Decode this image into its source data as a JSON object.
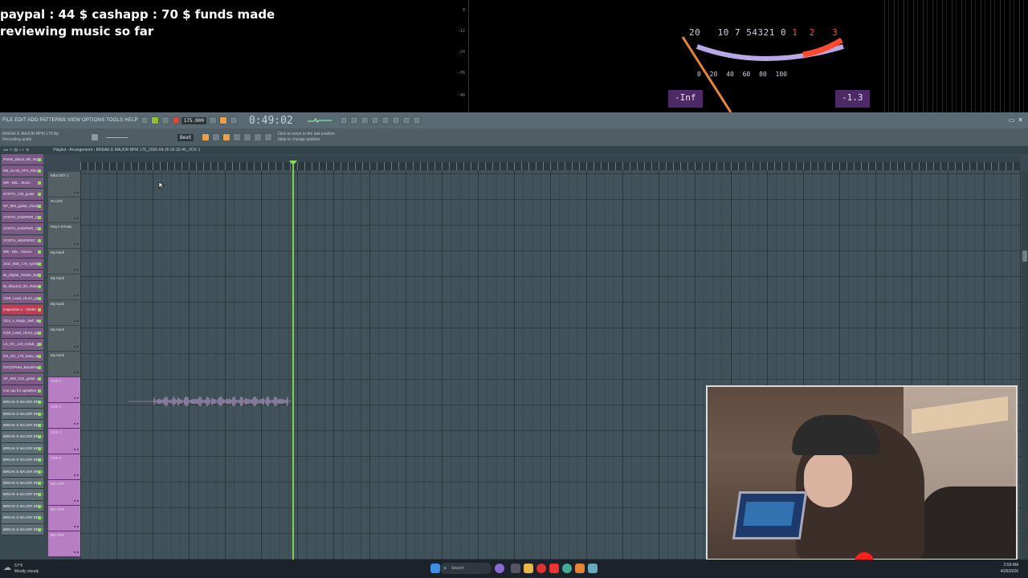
{
  "overlay": {
    "funds_line1": "paypal : 44 $  cashapp : 70 $ funds made",
    "funds_line2": "reviewing music so far",
    "vu_scale": [
      "20",
      "10",
      "7",
      "5",
      "4",
      "3",
      "2",
      "1",
      "0",
      "1",
      "2",
      "3"
    ],
    "vu_pct": [
      "0",
      "20",
      "40",
      "60",
      "80",
      "100"
    ],
    "vu_left_readout": "-Inf",
    "vu_right_readout": "-1.3"
  },
  "fl": {
    "menu": "FILE EDIT ADD PATTERNS VIEW OPTIONS TOOLS HELP",
    "time": "0:49:02",
    "tempo": "175.000",
    "status_line1": "RecordingAudio",
    "status_line2": "Recording audio",
    "hint_line1": "Click to move to the last position",
    "hint_line2": "Slide to change position",
    "playlist_header": "Playlist - Arrangement  ›  BREAK E MAJOR BPM 175_2026-04-26 02-30-45_VOX 1",
    "project_label": "BREAK E MAJOR BPM 175 Bp",
    "snap": "Beat",
    "picker_items": [
      {
        "label": "PHNK_Black_Mil_Nna...",
        "kind": "pattern"
      },
      {
        "label": "NB_SLAB_SFX_Elec...",
        "kind": "pattern"
      },
      {
        "label": "MR - Bla... Mono",
        "kind": "pattern"
      },
      {
        "label": "SYNTH_128_guitar",
        "kind": "pattern"
      },
      {
        "label": "SP_MM_guitar_chords",
        "kind": "pattern"
      },
      {
        "label": "SYNTH_ESWPER_11",
        "kind": "pattern"
      },
      {
        "label": "SYNTH_ESWPER_11...",
        "kind": "pattern"
      },
      {
        "label": "SYNTH_NEWSPEC",
        "kind": "pattern"
      },
      {
        "label": "MR - Bla... Nicest",
        "kind": "pattern"
      },
      {
        "label": "JGG_MID_175_synth",
        "kind": "pattern"
      },
      {
        "label": "BI_Digital_Stutter_Bell",
        "kind": "pattern"
      },
      {
        "label": "BI_Beyond_the_Rain",
        "kind": "pattern"
      },
      {
        "label": "CDE_Lead_chord_gui...",
        "kind": "pattern"
      },
      {
        "label": "Inspection 1 - 20260",
        "kind": "highlight"
      },
      {
        "label": "CE3_4_Magic_Bell_B...",
        "kind": "pattern"
      },
      {
        "label": "CDE_Lead_chord_gui...",
        "kind": "pattern"
      },
      {
        "label": "LS_DC_129_Imbdc_gui",
        "kind": "pattern"
      },
      {
        "label": "DS_DG_175_bass_w...",
        "kind": "pattern"
      },
      {
        "label": "GVOXPHM_Bandshot",
        "kind": "pattern"
      },
      {
        "label": "SP_MM_123_guitar...",
        "kind": "pattern"
      },
      {
        "label": "Inst cap for splashes",
        "kind": "pattern"
      },
      {
        "label": "BREAK E MAJOR BPM 175",
        "kind": "audio"
      },
      {
        "label": "BREAK E MAJOR BPM 175",
        "kind": "audio"
      },
      {
        "label": "BREAK E MAJOR BPM 175",
        "kind": "audio"
      },
      {
        "label": "BREAK E MAJOR BPM 175",
        "kind": "audio"
      },
      {
        "label": "BREAK E MAJOR BPM 175",
        "kind": "audio"
      },
      {
        "label": "BREAK E MAJOR BPM 175",
        "kind": "audio"
      },
      {
        "label": "BREAK E MAJOR BPM 175",
        "kind": "audio"
      },
      {
        "label": "BREAK E MAJOR BPM 175",
        "kind": "audio"
      },
      {
        "label": "BREAK E MAJOR BPM 175",
        "kind": "audio"
      },
      {
        "label": "BREAK E MAJOR BPM 175",
        "kind": "audio"
      },
      {
        "label": "BREAK E MAJOR BPM 175",
        "kind": "audio"
      },
      {
        "label": "BREAK E MAJOR BPM 175",
        "kind": "audio"
      }
    ],
    "tracks": [
      {
        "label": "MELODY 1",
        "pink": false
      },
      {
        "label": "PLUCK",
        "pink": false
      },
      {
        "label": "POLY RTHM",
        "pink": false
      },
      {
        "label": "My track",
        "pink": false
      },
      {
        "label": "My track",
        "pink": false
      },
      {
        "label": "My track",
        "pink": false
      },
      {
        "label": "My track",
        "pink": false
      },
      {
        "label": "My track",
        "pink": false
      },
      {
        "label": "VOX 1",
        "pink": true
      },
      {
        "label": "VOX 2",
        "pink": true
      },
      {
        "label": "VOX 3",
        "pink": true
      },
      {
        "label": "VOX 4",
        "pink": true
      },
      {
        "label": "BG VOX",
        "pink": true
      },
      {
        "label": "BG VOX",
        "pink": true
      },
      {
        "label": "BG VOX",
        "pink": true
      }
    ]
  },
  "taskbar": {
    "weather_temp": "57°F",
    "weather_desc": "Mostly cloudy",
    "search_placeholder": "Search",
    "time": "2:59 AM",
    "date": "4/26/2026"
  },
  "colors": {
    "playhead": "#7cd14a",
    "vu_red": "#ff4b2b",
    "readout_bg": "#4d2a66",
    "track_pink": "#b77ec4"
  }
}
